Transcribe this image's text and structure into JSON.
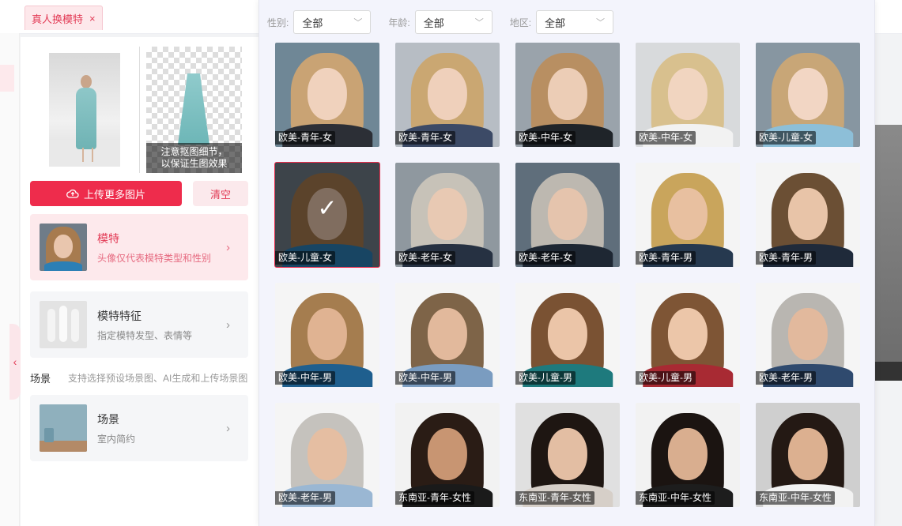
{
  "tab": {
    "label": "真人换模特",
    "close": "×"
  },
  "preview": {
    "note_line1": "注意抠图细节，",
    "note_line2": "以保证生图效果"
  },
  "buttons": {
    "upload": "上传更多图片",
    "clear": "清空"
  },
  "model_card": {
    "title": "模特",
    "subtitle": "头像仅代表模特类型和性别"
  },
  "feature_card": {
    "title": "模特特征",
    "subtitle": "指定模特发型、表情等"
  },
  "scene_section": {
    "title": "场景",
    "hint": "支持选择预设场景图、AI生成和上传场景图"
  },
  "scene_card": {
    "title": "场景",
    "subtitle": "室内简约"
  },
  "filters": [
    {
      "label": "性别:",
      "value": "全部"
    },
    {
      "label": "年龄:",
      "value": "全部"
    },
    {
      "label": "地区:",
      "value": "全部"
    }
  ],
  "models": [
    {
      "caption": "欧美-青年-女",
      "hair": "#c9a374",
      "skin": "#f0d2bd",
      "bg": "#6f8796",
      "shirt": "#2c2f36"
    },
    {
      "caption": "欧美-青年-女",
      "hair": "#caa772",
      "skin": "#efd0bb",
      "bg": "#b7bdc4",
      "shirt": "#3c4a66"
    },
    {
      "caption": "欧美-中年-女",
      "hair": "#b88f62",
      "skin": "#eccdb6",
      "bg": "#9aa3ab",
      "shirt": "#1f2429"
    },
    {
      "caption": "欧美-中年-女",
      "hair": "#d8c08e",
      "skin": "#f1d5c0",
      "bg": "#d8dadc",
      "shirt": "#f2f2f2"
    },
    {
      "caption": "欧美-儿童-女",
      "hair": "#c8a677",
      "skin": "#f2d6c4",
      "bg": "#8796a1",
      "shirt": "#8dbfd8"
    },
    {
      "caption": "欧美-儿童-女",
      "hair": "#a77b4f",
      "skin": "#e9c6ae",
      "bg": "#6f7c88",
      "shirt": "#2c7fb5",
      "selected": true
    },
    {
      "caption": "欧美-老年-女",
      "hair": "#c7c2b8",
      "skin": "#e8c9b3",
      "bg": "#8f989f",
      "shirt": "#263142"
    },
    {
      "caption": "欧美-老年-女",
      "hair": "#bdb8b0",
      "skin": "#e5c4ad",
      "bg": "#5f6e7b",
      "shirt": "#1e2733"
    },
    {
      "caption": "欧美-青年-男",
      "hair": "#c9a55c",
      "skin": "#e8c0a0",
      "bg": "#f4f4f4",
      "shirt": "#26394f"
    },
    {
      "caption": "欧美-青年-男",
      "hair": "#6b4f34",
      "skin": "#e8c4a8",
      "bg": "#f4f4f4",
      "shirt": "#1f2a3a"
    },
    {
      "caption": "欧美-中年-男",
      "hair": "#a57d4f",
      "skin": "#e0b392",
      "bg": "#f5f5f5",
      "shirt": "#1f5f8e"
    },
    {
      "caption": "欧美-中年-男",
      "hair": "#7e6448",
      "skin": "#e2b99c",
      "bg": "#f5f5f5",
      "shirt": "#7a9cc0"
    },
    {
      "caption": "欧美-儿童-男",
      "hair": "#7a5233",
      "skin": "#ebc5a8",
      "bg": "#f5f5f5",
      "shirt": "#1e7a7d"
    },
    {
      "caption": "欧美-儿童-男",
      "hair": "#7e5535",
      "skin": "#ecc6a9",
      "bg": "#f5f5f5",
      "shirt": "#a82a33"
    },
    {
      "caption": "欧美-老年-男",
      "hair": "#b9b6b1",
      "skin": "#e2b99d",
      "bg": "#f5f5f5",
      "shirt": "#2f4a6e"
    },
    {
      "caption": "欧美-老年-男",
      "hair": "#c5c2bd",
      "skin": "#e5bea2",
      "bg": "#f5f5f5",
      "shirt": "#9ab7d3"
    },
    {
      "caption": "东南亚-青年-女性",
      "hair": "#2a1c15",
      "skin": "#c89572",
      "bg": "#f2f2f2",
      "shirt": "#1a1a1a"
    },
    {
      "caption": "东南亚-青年-女性",
      "hair": "#1e1612",
      "skin": "#e3bea3",
      "bg": "#e0e0e0",
      "shirt": "#d6cfc8"
    },
    {
      "caption": "东南亚-中年-女性",
      "hair": "#1b1411",
      "skin": "#d9ae8f",
      "bg": "#f2f2f2",
      "shirt": "#1d1d1d"
    },
    {
      "caption": "东南亚-中年-女性",
      "hair": "#241914",
      "skin": "#dcb090",
      "bg": "#cfcfcf",
      "shirt": "#f2f2f2"
    }
  ]
}
